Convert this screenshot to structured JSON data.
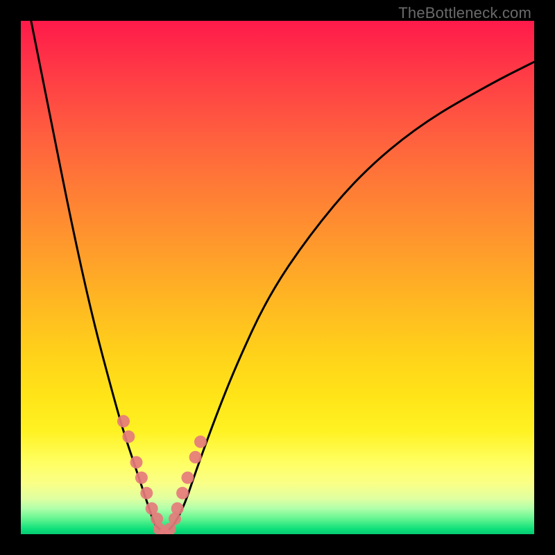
{
  "watermark": "TheBottleneck.com",
  "chart_data": {
    "type": "line",
    "title": "",
    "xlabel": "",
    "ylabel": "",
    "xlim": [
      0,
      100
    ],
    "ylim": [
      0,
      100
    ],
    "series": [
      {
        "name": "bottleneck-curve",
        "x": [
          2,
          6,
          10,
          14,
          18,
          20,
          22,
          24,
          25,
          26,
          27,
          28,
          30,
          32,
          34,
          38,
          42,
          48,
          56,
          66,
          78,
          92,
          100
        ],
        "values": [
          100,
          80,
          60,
          42,
          27,
          20,
          14,
          8,
          5,
          2,
          1,
          0,
          2,
          6,
          12,
          23,
          33,
          46,
          58,
          70,
          80,
          88,
          92
        ]
      }
    ],
    "points_on_curve": {
      "name": "highlight-dots",
      "x": [
        20,
        21,
        22.5,
        23.5,
        24.5,
        25.5,
        26.5,
        27,
        28,
        29,
        30,
        30.5,
        31.5,
        32.5,
        34,
        35
      ],
      "values": [
        22,
        19,
        14,
        11,
        8,
        5,
        3,
        1,
        0,
        1,
        3,
        5,
        8,
        11,
        15,
        18
      ]
    },
    "gradient_stops": [
      {
        "pos": 0,
        "color": "#ff1a4a"
      },
      {
        "pos": 50,
        "color": "#ffb822"
      },
      {
        "pos": 86,
        "color": "#ffff62"
      },
      {
        "pos": 100,
        "color": "#07c972"
      }
    ]
  }
}
